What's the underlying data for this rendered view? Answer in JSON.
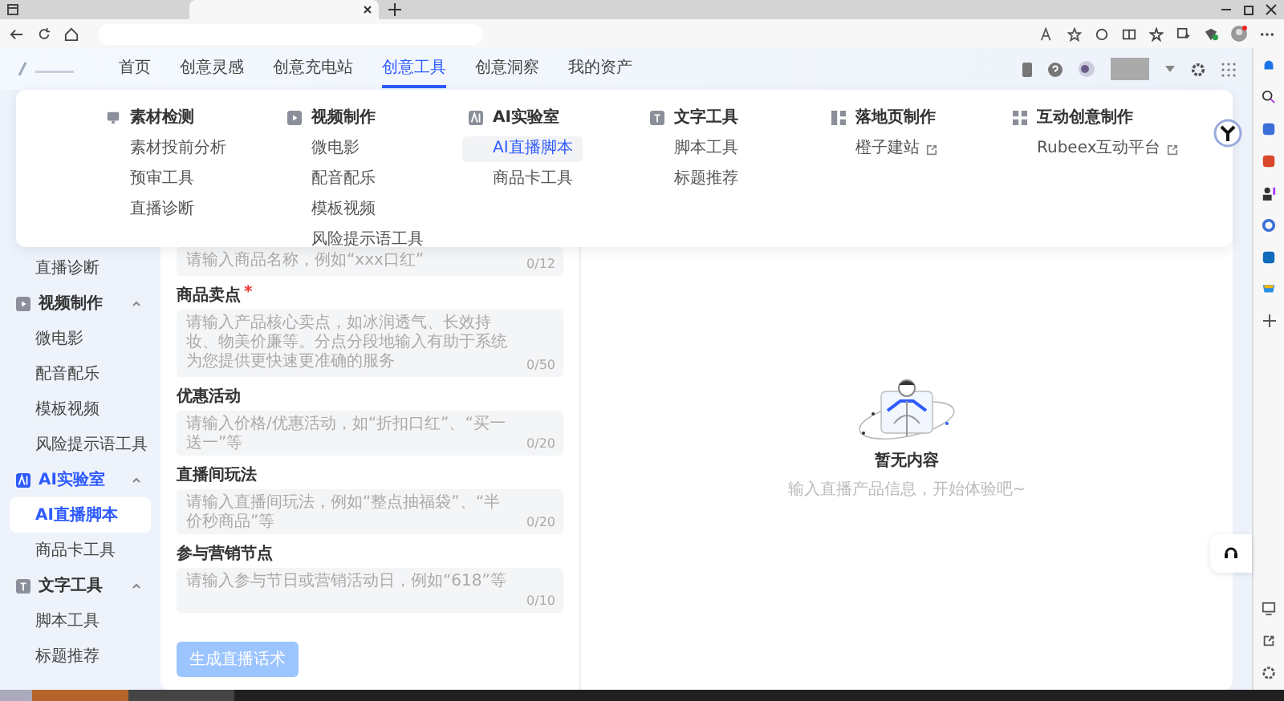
{
  "header": {
    "nav": [
      {
        "label": "首页",
        "selected": false
      },
      {
        "label": "创意灵感",
        "selected": false
      },
      {
        "label": "创意充电站",
        "selected": false
      },
      {
        "label": "创意工具",
        "selected": true
      },
      {
        "label": "创意洞察",
        "selected": false
      },
      {
        "label": "我的资产",
        "selected": false
      }
    ]
  },
  "menu": {
    "columns": [
      {
        "title": "素材检测",
        "kind": "monitor",
        "items": [
          {
            "label": "素材投前分析",
            "selected": false,
            "external": false
          },
          {
            "label": "预审工具",
            "selected": false,
            "external": false
          },
          {
            "label": "直播诊断",
            "selected": false,
            "external": false
          }
        ]
      },
      {
        "title": "视频制作",
        "kind": "play",
        "items": [
          {
            "label": "微电影",
            "selected": false,
            "external": false
          },
          {
            "label": "配音配乐",
            "selected": false,
            "external": false
          },
          {
            "label": "模板视频",
            "selected": false,
            "external": false
          },
          {
            "label": "风险提示语工具",
            "selected": false,
            "external": false
          }
        ]
      },
      {
        "title": "AI实验室",
        "kind": "ai",
        "items": [
          {
            "label": "AI直播脚本",
            "selected": true,
            "external": false
          },
          {
            "label": "商品卡工具",
            "selected": false,
            "external": false
          }
        ]
      },
      {
        "title": "文字工具",
        "kind": "text",
        "items": [
          {
            "label": "脚本工具",
            "selected": false,
            "external": false
          },
          {
            "label": "标题推荐",
            "selected": false,
            "external": false
          }
        ]
      },
      {
        "title": "落地页制作",
        "kind": "page",
        "items": [
          {
            "label": "橙子建站",
            "selected": false,
            "external": true
          }
        ]
      },
      {
        "title": "互动创意制作",
        "kind": "grid",
        "items": [
          {
            "label": "Rubeex互动平台",
            "selected": false,
            "external": true
          }
        ]
      }
    ]
  },
  "sidebar": {
    "items": [
      {
        "kind": "item",
        "label": "直播诊断",
        "selected": false
      },
      {
        "kind": "group",
        "label": "视频制作",
        "expanded": true
      },
      {
        "kind": "item",
        "label": "微电影",
        "selected": false
      },
      {
        "kind": "item",
        "label": "配音配乐",
        "selected": false
      },
      {
        "kind": "item",
        "label": "模板视频",
        "selected": false
      },
      {
        "kind": "item",
        "label": "风险提示语工具",
        "selected": false
      },
      {
        "kind": "group",
        "label": "AI实验室",
        "expanded": true
      },
      {
        "kind": "item",
        "label": "AI直播脚本",
        "selected": true
      },
      {
        "kind": "item",
        "label": "商品卡工具",
        "selected": false
      },
      {
        "kind": "group",
        "label": "文字工具",
        "expanded": true
      },
      {
        "kind": "item",
        "label": "脚本工具",
        "selected": false
      },
      {
        "kind": "item",
        "label": "标题推荐",
        "selected": false
      }
    ]
  },
  "form": {
    "fields": [
      {
        "kind": "input",
        "placeholder": "请输入商品名称，例如“xxx口红”",
        "counter": "0/12"
      },
      {
        "kind": "textarea",
        "label": "商品卖点",
        "required_mark": "*",
        "placeholder": "请输入产品核心卖点，如冰润透气、长效持妆、物美价廉等。分点分段地输入有助于系统为您提供更快速更准确的服务",
        "counter": "0/50"
      },
      {
        "kind": "input",
        "label": "优惠活动",
        "placeholder": "请输入价格/优惠活动，如“折扣口红”、“买一送一”等",
        "counter": "0/20"
      },
      {
        "kind": "input",
        "label": "直播间玩法",
        "placeholder": "请输入直播间玩法，例如“整点抽福袋”、“半价秒商品”等",
        "counter": "0/20"
      },
      {
        "kind": "input",
        "label": "参与营销节点",
        "placeholder": "请输入参与节日或营销活动日，例如“618”等",
        "counter": "0/10"
      }
    ],
    "submit": {
      "label": "生成直播话术",
      "disabled": true
    }
  },
  "result": {
    "title": "暂无内容",
    "subtitle": "输入直播产品信息，开始体验吧~"
  }
}
